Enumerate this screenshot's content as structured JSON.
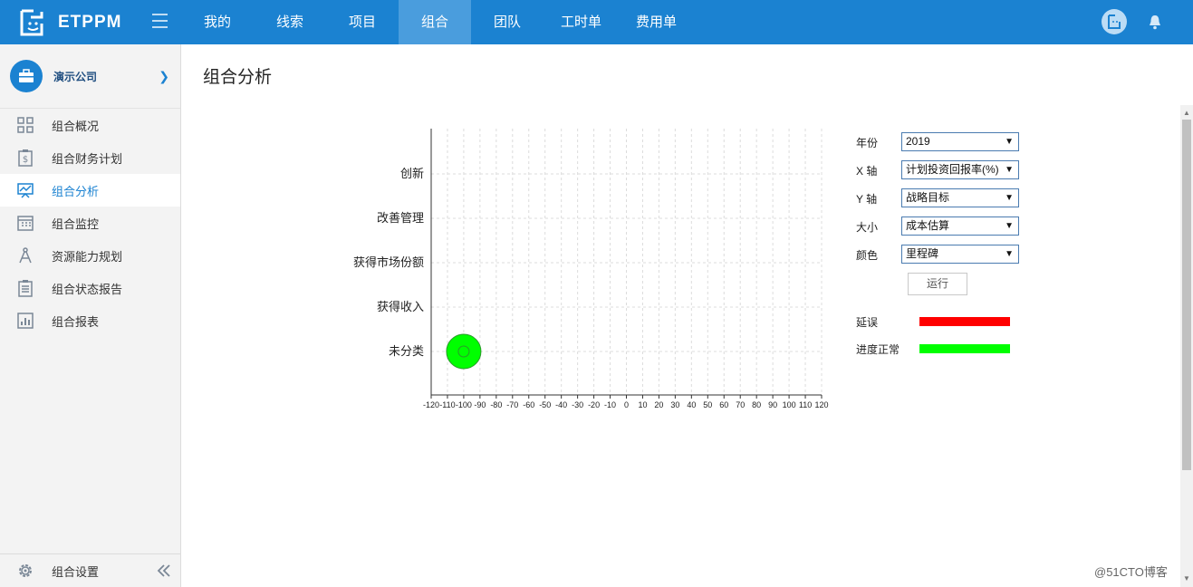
{
  "app": {
    "logo_text": "ETPPM"
  },
  "nav": {
    "items": [
      "我的",
      "线索",
      "项目",
      "组合",
      "团队",
      "工时单",
      "费用单"
    ],
    "active_index": 3
  },
  "sidebar": {
    "company": "演示公司",
    "items": [
      {
        "label": "组合概况",
        "icon": "grid-icon"
      },
      {
        "label": "组合财务计划",
        "icon": "dollar-doc-icon"
      },
      {
        "label": "组合分析",
        "icon": "chart-board-icon"
      },
      {
        "label": "组合监控",
        "icon": "calendar-icon"
      },
      {
        "label": "资源能力规划",
        "icon": "compass-icon"
      },
      {
        "label": "组合状态报告",
        "icon": "clipboard-icon"
      },
      {
        "label": "组合报表",
        "icon": "bar-report-icon"
      }
    ],
    "active_index": 2,
    "footer_label": "组合设置"
  },
  "main": {
    "title": "组合分析"
  },
  "controls": {
    "year_label": "年份",
    "year_value": "2019",
    "x_label": "X 轴",
    "x_value": "计划投资回报率(%)",
    "y_label": "Y 轴",
    "y_value": "战略目标",
    "size_label": "大小",
    "size_value": "成本估算",
    "color_label": "颜色",
    "color_value": "里程碑",
    "run_label": "运行"
  },
  "legend": [
    {
      "label": "延误",
      "color": "#ff0000"
    },
    {
      "label": "进度正常",
      "color": "#00ff00"
    }
  ],
  "chart_data": {
    "type": "scatter",
    "x_ticks": [
      -120,
      -110,
      -100,
      -90,
      -80,
      -70,
      -60,
      -50,
      -40,
      -30,
      -20,
      -10,
      0,
      10,
      20,
      30,
      40,
      50,
      60,
      70,
      80,
      90,
      100,
      110,
      120
    ],
    "xlim": [
      -120,
      120
    ],
    "y_categories": [
      "创新",
      "改善管理",
      "获得市场份额",
      "获得收入",
      "未分类"
    ],
    "grid": true,
    "points": [
      {
        "x": -100,
        "y": "未分类",
        "color": "#00ff00"
      }
    ]
  },
  "watermark": "@51CTO博客"
}
